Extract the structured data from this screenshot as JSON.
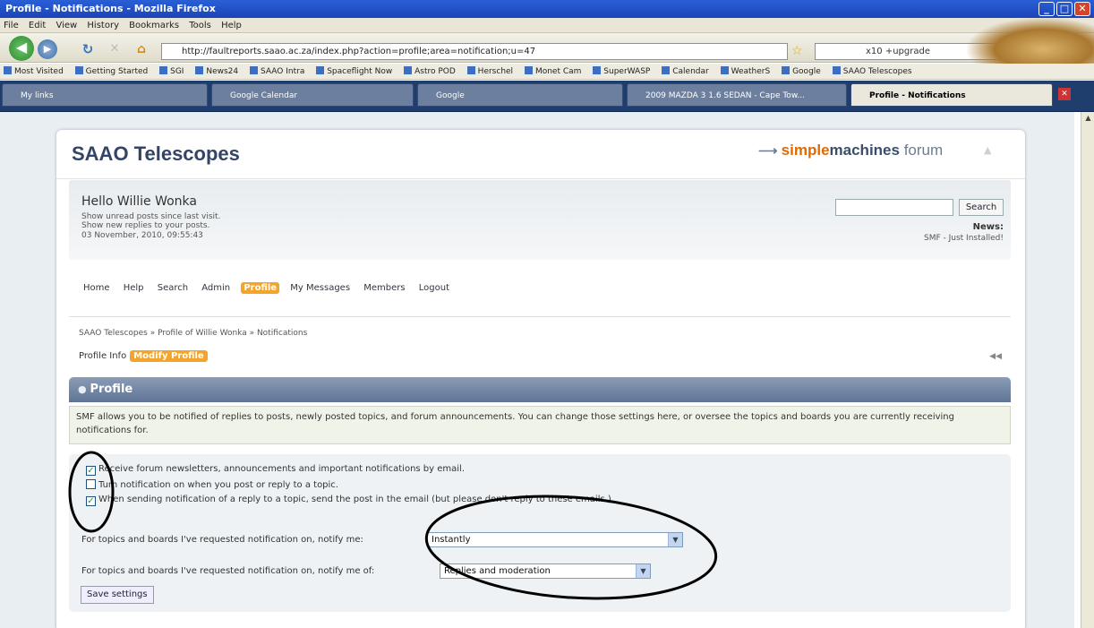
{
  "browser": {
    "window_title": "Profile - Notifications - Mozilla Firefox",
    "menu": [
      "File",
      "Edit",
      "View",
      "History",
      "Bookmarks",
      "Tools",
      "Help"
    ],
    "url": "http://faultreports.saao.ac.za/index.php?action=profile;area=notification;u=47",
    "search_text": "x10 +upgrade",
    "bookmarks": [
      "Most Visited",
      "Getting Started",
      "SGI",
      "News24",
      "SAAO Intra",
      "Spaceflight Now",
      "Astro POD",
      "Herschel",
      "Monet Cam",
      "SuperWASP",
      "Calendar",
      "WeatherS",
      "Google",
      "SAAO Telescopes"
    ],
    "tabs": [
      {
        "label": "My links"
      },
      {
        "label": "Google Calendar"
      },
      {
        "label": "Google"
      },
      {
        "label": "2009 MAZDA 3 1.6 SEDAN - Cape Tow..."
      },
      {
        "label": "Profile - Notifications"
      }
    ]
  },
  "forum": {
    "title": "SAAO Telescopes",
    "logo": {
      "simple": "simple",
      "machines": "machines",
      "forum": "forum"
    },
    "greeting": "Hello Willie Wonka",
    "user_links": [
      "Show unread posts since last visit.",
      "Show new replies to your posts."
    ],
    "datetime": "03 November, 2010, 09:55:43",
    "search_button": "Search",
    "news_label": "News:",
    "news_text": "SMF - Just Installed!",
    "menu": [
      "Home",
      "Help",
      "Search",
      "Admin",
      "Profile",
      "My Messages",
      "Members",
      "Logout"
    ],
    "active_menu": "Profile",
    "breadcrumb": "SAAO Telescopes » Profile of Willie Wonka » Notifications",
    "profile_info": "Profile Info",
    "modify_profile": "Modify Profile",
    "section_title": "Profile",
    "description": "SMF allows you to be notified of replies to posts, newly posted topics, and forum announcements. You can change those settings here, or oversee the topics and boards you are currently receiving notifications for.",
    "checkboxes": [
      {
        "label": "Receive forum newsletters, announcements and important notifications by email.",
        "checked": true
      },
      {
        "label": "Turn notification on when you post or reply to a topic.",
        "checked": false
      },
      {
        "label": "When sending notification of a reply to a topic, send the post in the email (but please don't reply to these emails.)",
        "checked": true
      }
    ],
    "notify_when_label": "For topics and boards I've requested notification on, notify me:",
    "notify_when_value": "Instantly",
    "notify_of_label": "For topics and boards I've requested notification on, notify me of:",
    "notify_of_value": "Replies and moderation",
    "save_button": "Save settings"
  },
  "colors": {
    "accent": "#f2a42b",
    "title": "#334466",
    "annotation": "#000000"
  }
}
